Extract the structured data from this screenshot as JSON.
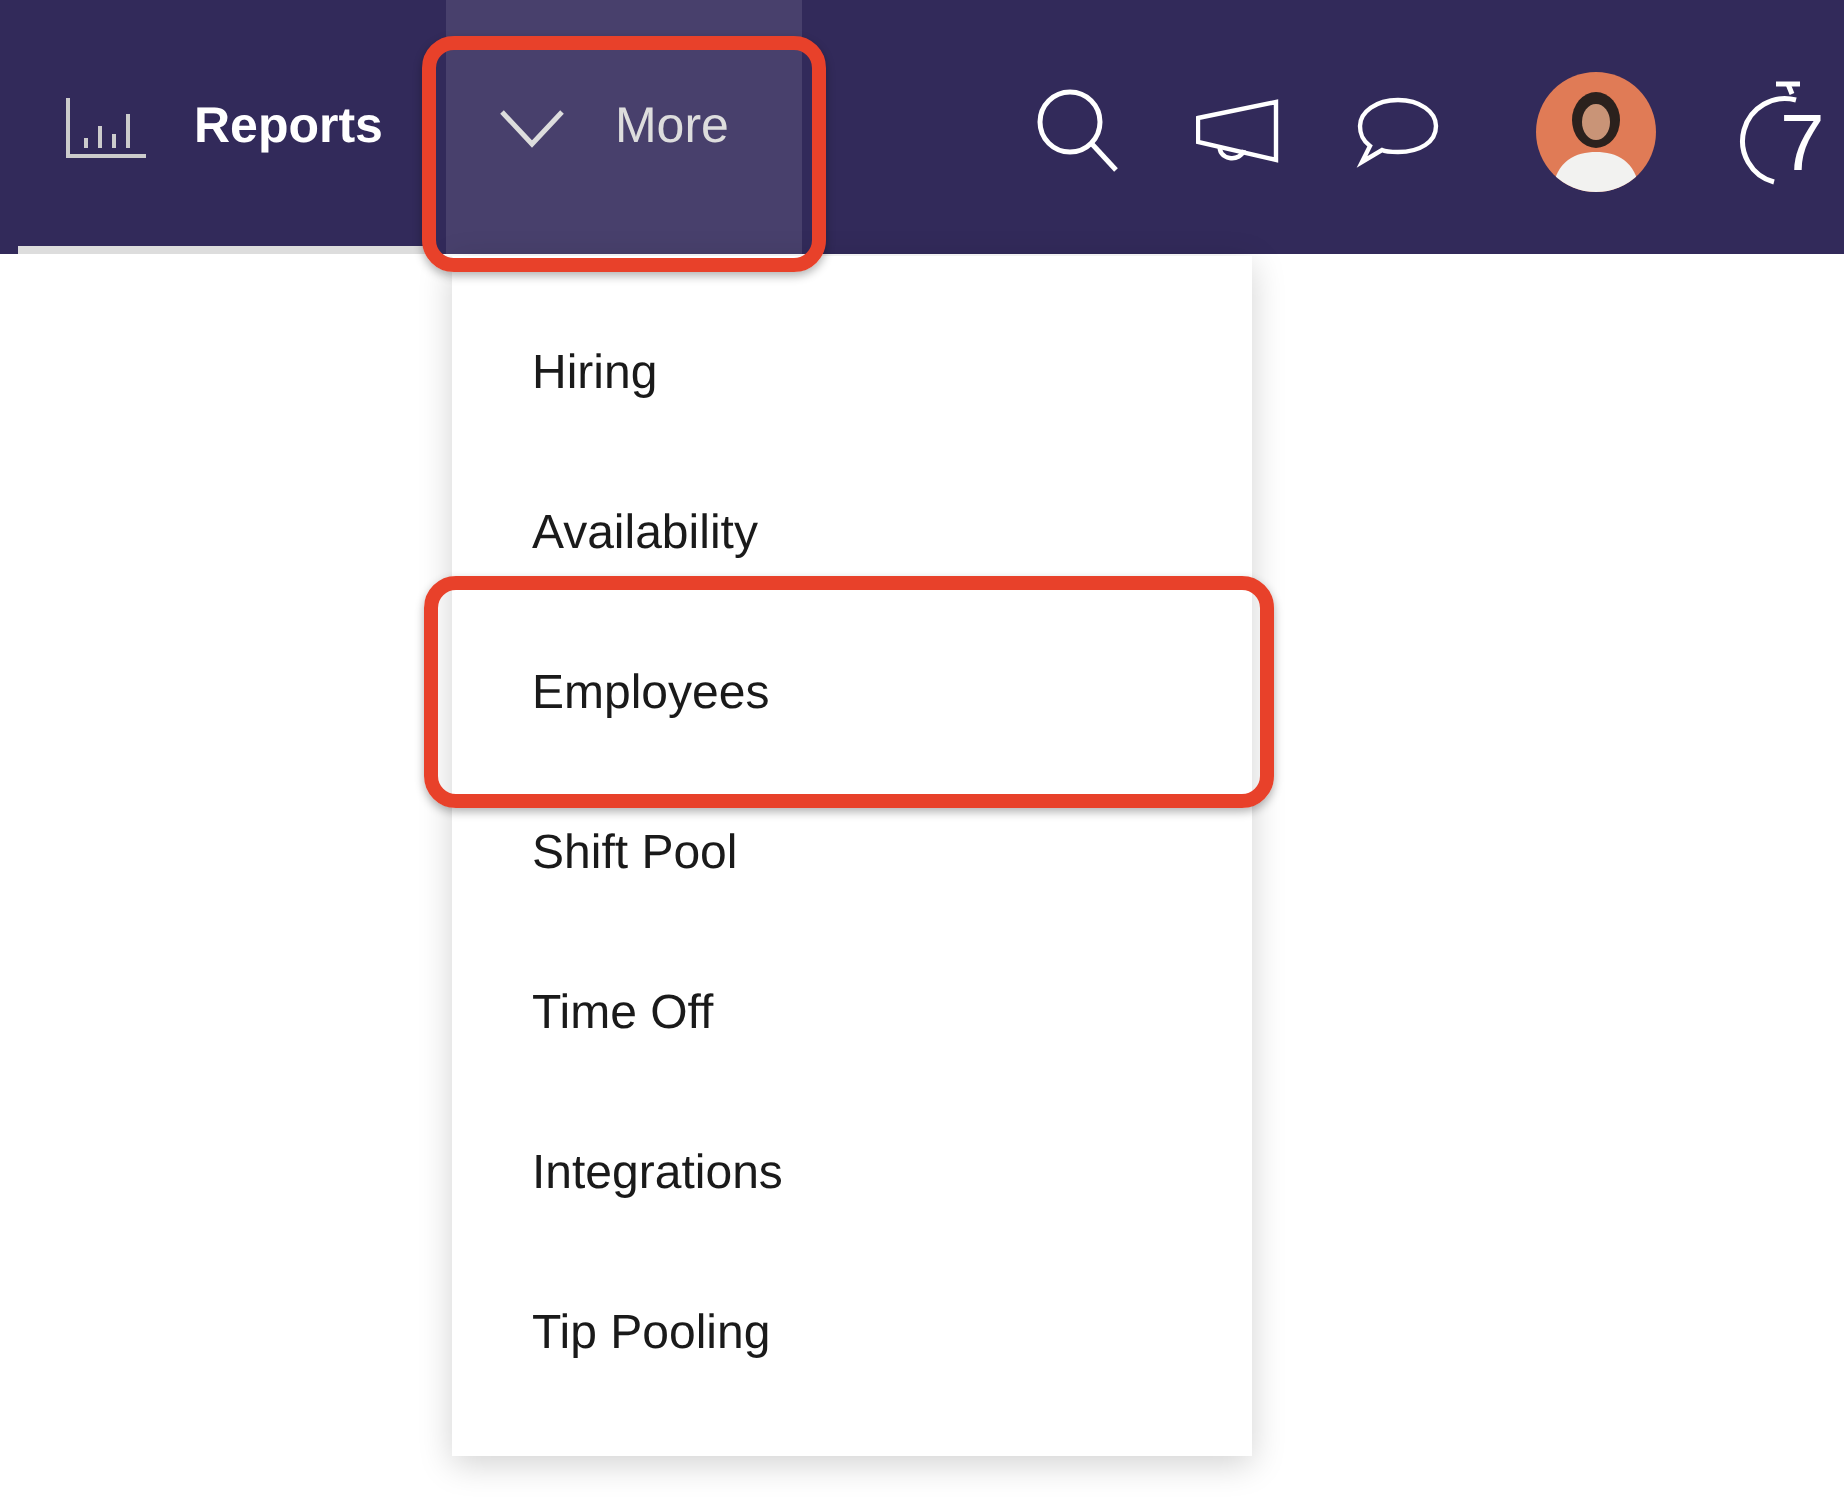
{
  "navbar": {
    "tabs": [
      {
        "label": "Reports",
        "selected": true,
        "highlighted": false
      },
      {
        "label": "More",
        "selected": false,
        "highlighted": true,
        "expanded": true
      }
    ],
    "logo": "7"
  },
  "dropdown": {
    "items": [
      {
        "label": "Hiring",
        "highlighted": false
      },
      {
        "label": "Availability",
        "highlighted": false
      },
      {
        "label": "Employees",
        "highlighted": true
      },
      {
        "label": "Shift Pool",
        "highlighted": false
      },
      {
        "label": "Time Off",
        "highlighted": false
      },
      {
        "label": "Integrations",
        "highlighted": false
      },
      {
        "label": "Tip Pooling",
        "highlighted": false
      }
    ]
  }
}
